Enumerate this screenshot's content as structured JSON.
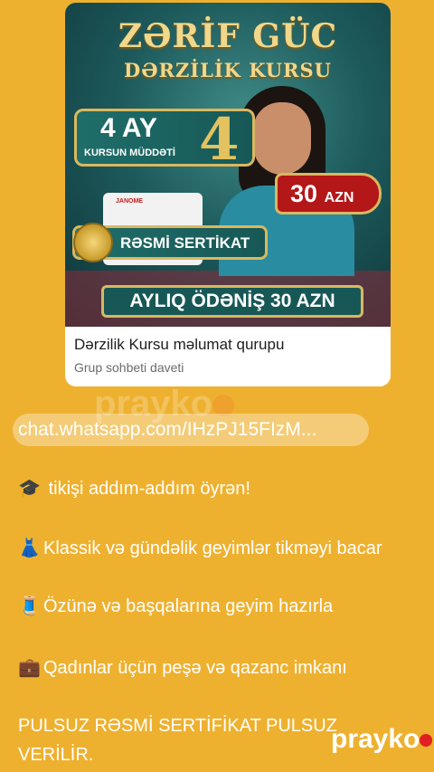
{
  "card": {
    "banner": {
      "title": "ZƏRİF GÜC",
      "subtitle": "DƏRZİLİK KURSU",
      "duration_big": "4 AY",
      "duration_small": "KURSUN MÜDDƏTİ",
      "duration_number": "4",
      "price": "30",
      "price_unit": "AZN",
      "machine_brand": "JANOME",
      "certificate": "RƏSMİ SERTİKAT",
      "monthly_payment": "AYLIQ ÖDƏNİŞ 30 AZN"
    },
    "name": "Dərzilik Kursu məlumat qurupu",
    "description": "Grup sohbeti daveti"
  },
  "link": "chat.whatsapp.com/IHzPJ15FIzM...",
  "watermark": "prayko",
  "lines": [
    {
      "icon": "🎓",
      "text": "tikişi addım-addım öyrən!"
    },
    {
      "icon": "👗",
      "text": "Klassik və gündəlik geyimlər tikməyi bacar"
    },
    {
      "icon": "🧵",
      "text": "Özünə və başqalarına geyim hazırla"
    },
    {
      "icon": "💼",
      "text": "Qadınlar üçün peşə və qazanc imkanı"
    }
  ],
  "footer_text": "PULSUZ RƏSMİ SERTİFİKAT PULSUZ VERİLİR."
}
